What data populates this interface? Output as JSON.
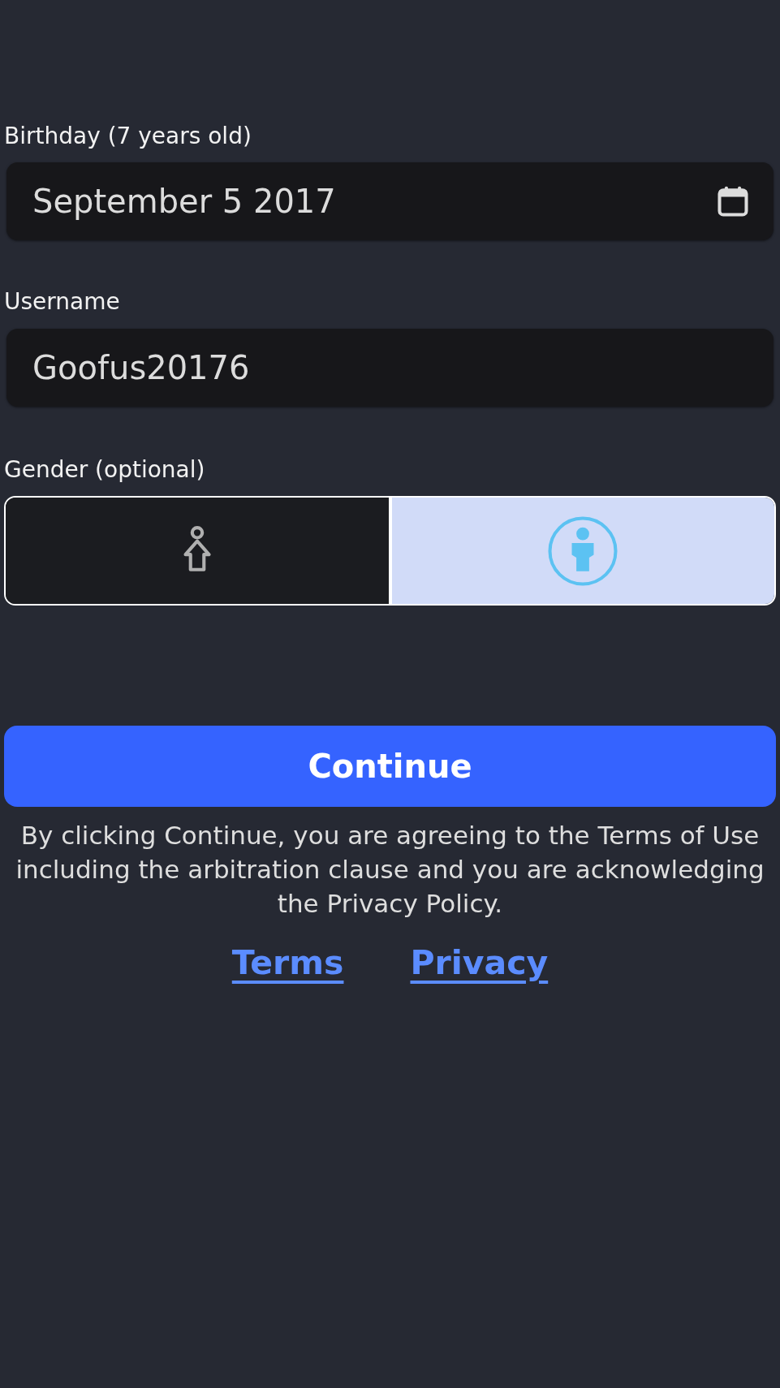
{
  "birthday": {
    "label": "Birthday (7 years old)",
    "value": "September 5 2017"
  },
  "username": {
    "label": "Username",
    "value": "Goofus20176"
  },
  "gender": {
    "label": "Gender (optional)",
    "options": [
      {
        "kind": "female",
        "selected": false
      },
      {
        "kind": "male",
        "selected": true
      }
    ]
  },
  "continue_button": "Continue",
  "disclaimer": "By clicking Continue, you are agreeing to the Terms of Use including the arbitration clause and you are acknowledging the Privacy Policy.",
  "links": [
    "Terms",
    "Privacy"
  ]
}
